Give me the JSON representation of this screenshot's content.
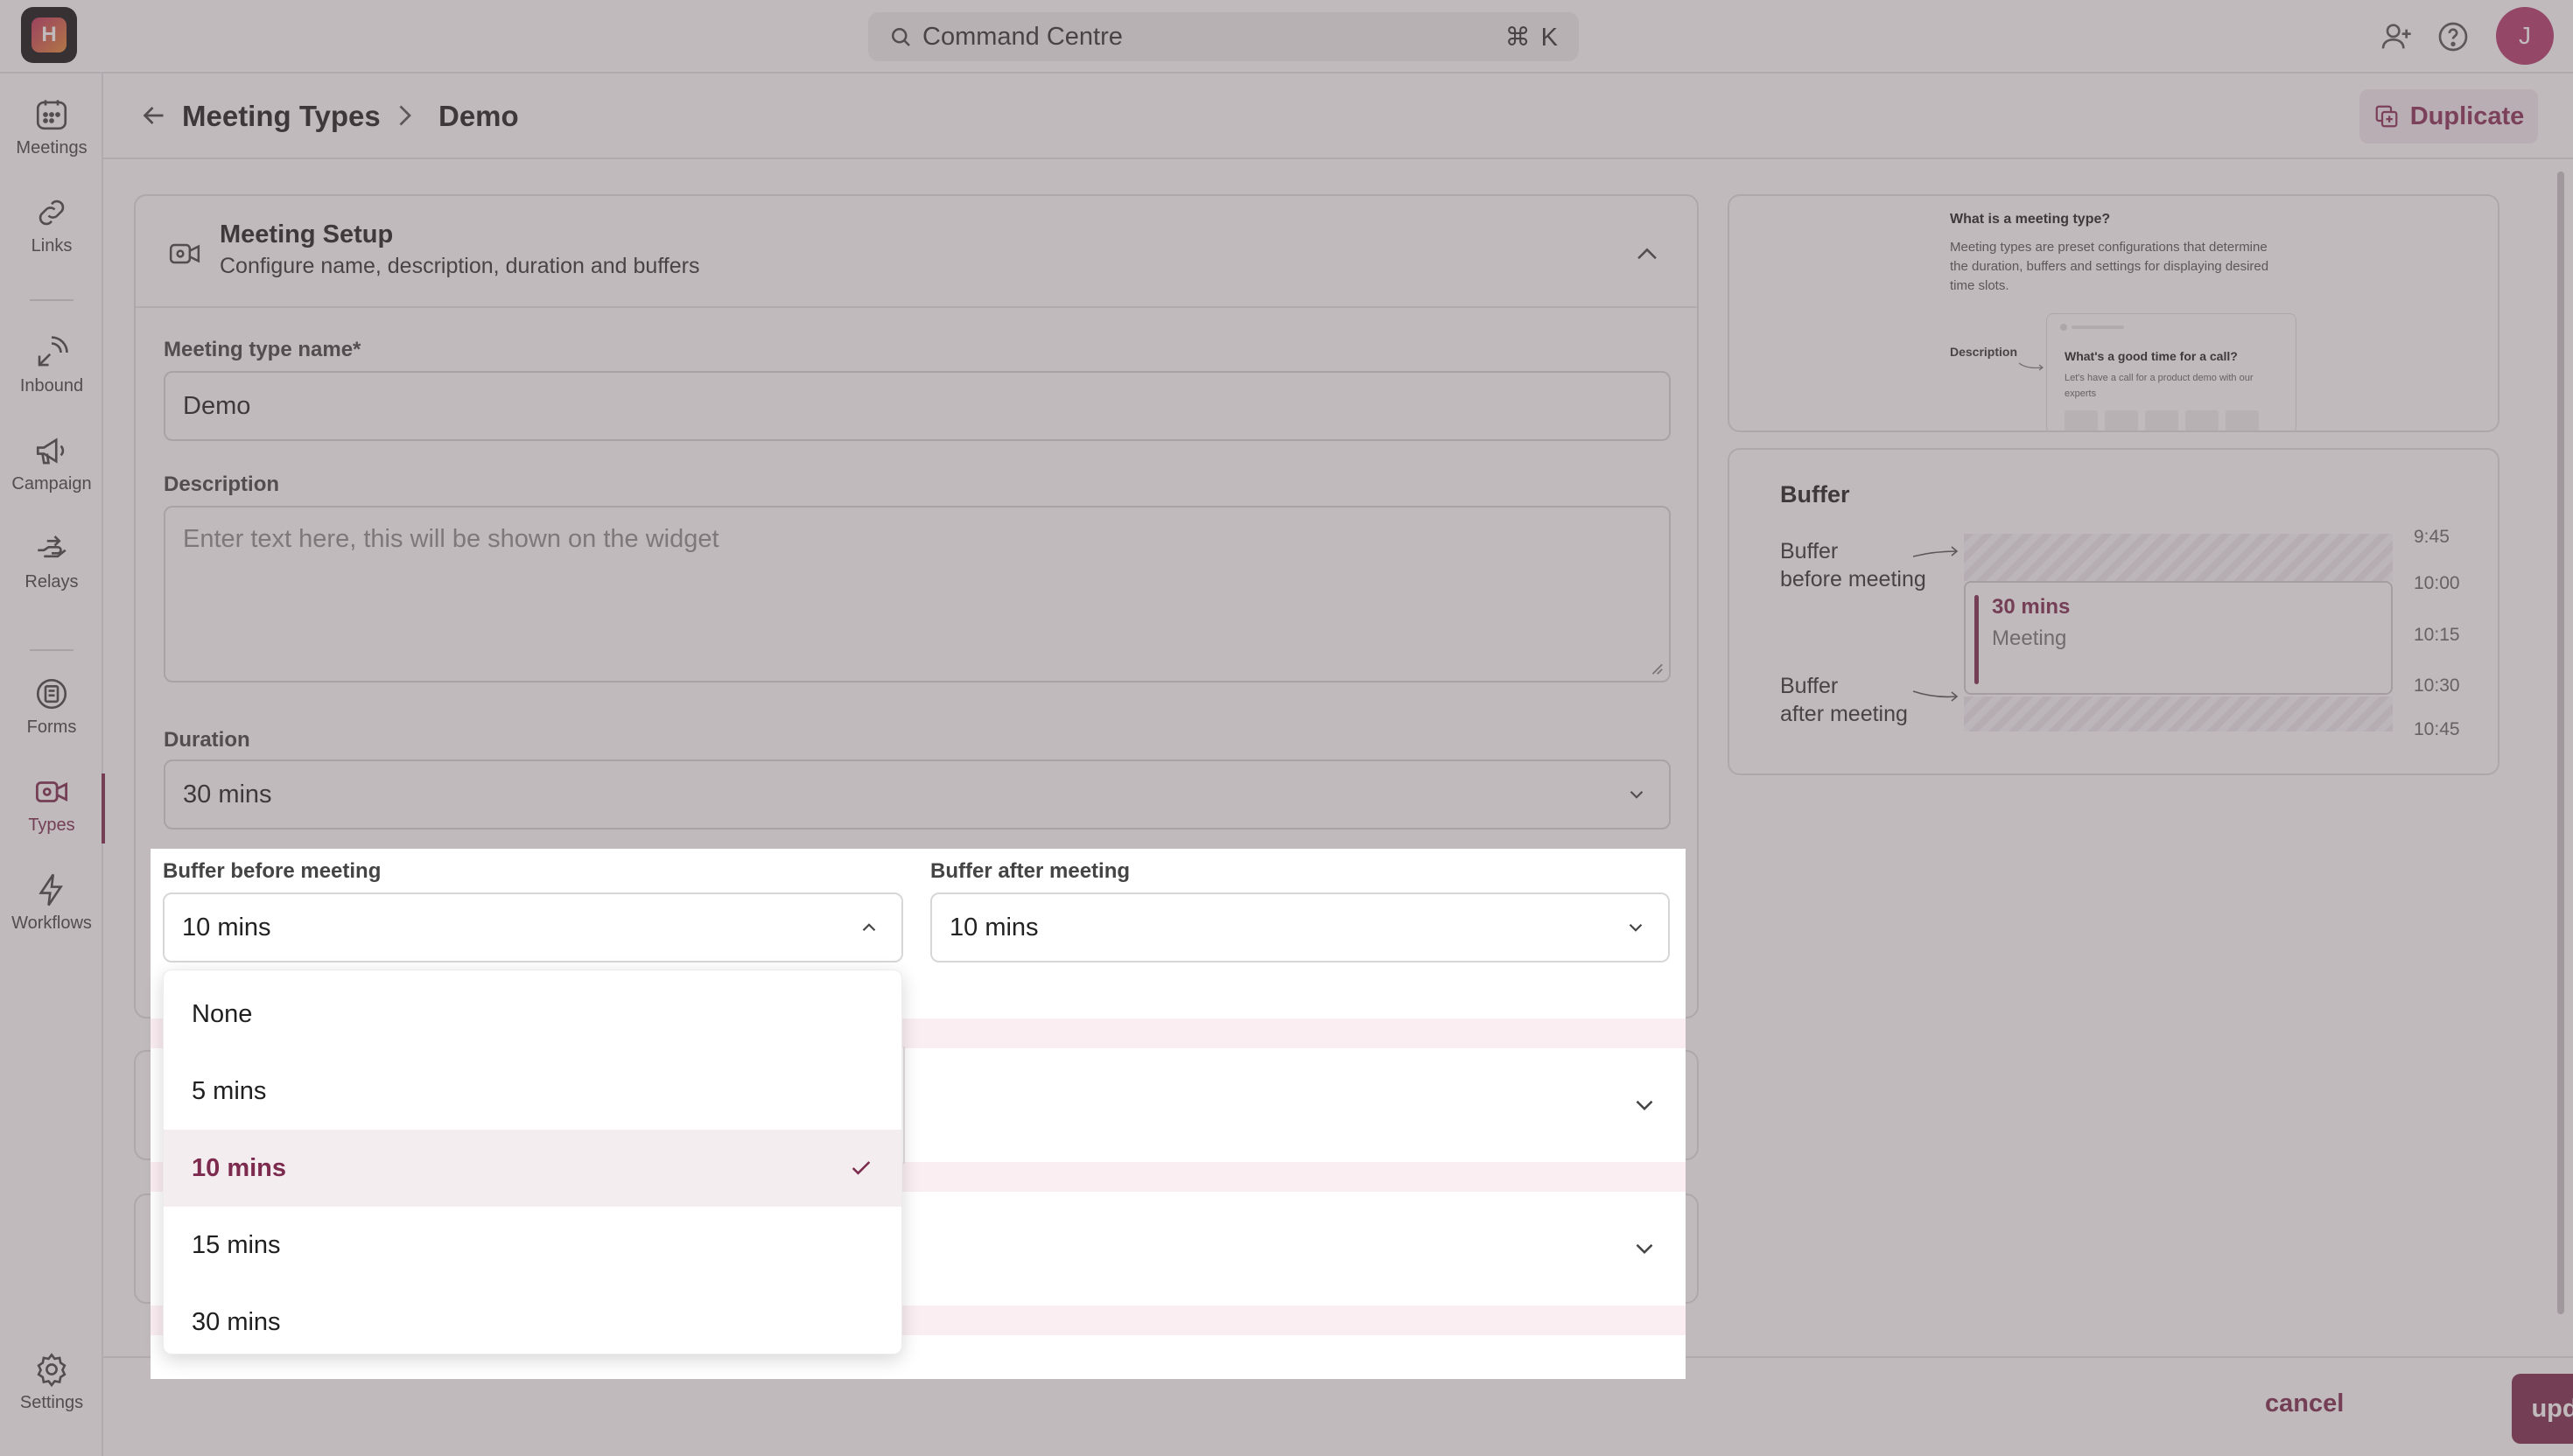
{
  "topbar": {
    "search_label": "Command Centre",
    "search_shortcut": "⌘ K",
    "avatar_initial": "J"
  },
  "sidebar": {
    "items": [
      {
        "label": "Meetings",
        "icon": "calendar-icon"
      },
      {
        "label": "Links",
        "icon": "link-icon"
      },
      {
        "label": "Inbound",
        "icon": "inbound-icon"
      },
      {
        "label": "Campaign",
        "icon": "megaphone-icon"
      },
      {
        "label": "Relays",
        "icon": "relay-hand-icon"
      },
      {
        "label": "Forms",
        "icon": "forms-icon"
      },
      {
        "label": "Types",
        "icon": "video-icon",
        "active": true
      },
      {
        "label": "Workflows",
        "icon": "lightning-icon"
      },
      {
        "label": "Settings",
        "icon": "gear-icon"
      }
    ]
  },
  "header": {
    "parent": "Meeting Types",
    "current": "Demo",
    "duplicate_label": "Duplicate"
  },
  "setup": {
    "title": "Meeting Setup",
    "subtitle": "Configure name, description, duration and buffers",
    "name_label": "Meeting type name*",
    "name_value": "Demo",
    "description_label": "Description",
    "description_placeholder": "Enter text here, this will be shown on the widget",
    "duration_label": "Duration",
    "duration_value": "30 mins",
    "buffer_before_label": "Buffer before meeting",
    "buffer_before_value": "10 mins",
    "buffer_after_label": "Buffer after meeting",
    "buffer_after_value": "10 mins"
  },
  "dropdown": {
    "options": [
      "None",
      "5 mins",
      "10 mins",
      "15 mins",
      "30 mins"
    ],
    "selected": "10 mins"
  },
  "help": {
    "title": "What is a meeting type?",
    "text": "Meeting types are preset configurations that determine the duration, buffers and settings for displaying desired time slots.",
    "description_label": "Description",
    "example_title": "What's a good time for a call?",
    "example_text": "Let's have a call for a product demo with our experts"
  },
  "buffer_panel": {
    "title": "Buffer",
    "before_label": "Buffer\nbefore meeting",
    "after_label": "Buffer\nafter meeting",
    "meeting_duration": "30 mins",
    "meeting_label": "Meeting",
    "times": [
      "9:45",
      "10:00",
      "10:15",
      "10:30",
      "10:45"
    ]
  },
  "footer": {
    "cancel_label": "cancel",
    "update_label": "update"
  },
  "colors": {
    "accent": "#7c2a4d",
    "overlay": "#695a62"
  }
}
